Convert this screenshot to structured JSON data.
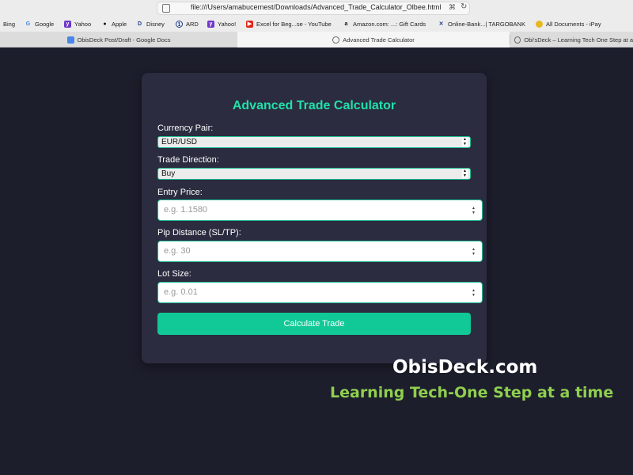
{
  "browser": {
    "url": "file:///Users/amabucernest/Downloads/Advanced_Trade_Calculator_Olbee.html",
    "bookmarks": [
      {
        "label": "Bing",
        "icon": "bing-icon"
      },
      {
        "label": "Google",
        "icon": "google-icon"
      },
      {
        "label": "Yahoo",
        "icon": "yahoo-icon"
      },
      {
        "label": "Apple",
        "icon": "apple-icon"
      },
      {
        "label": "Disney",
        "icon": "disney-icon"
      },
      {
        "label": "ARD",
        "icon": "ard-icon"
      },
      {
        "label": "Yahoo!",
        "icon": "yahoo-icon"
      },
      {
        "label": "Excel for Beg...se - YouTube",
        "icon": "youtube-icon"
      },
      {
        "label": "Amazon.com: ...: Gift Cards",
        "icon": "amazon-icon"
      },
      {
        "label": "Online-Bank...| TARGOBANK",
        "icon": "targobank-icon"
      },
      {
        "label": "All Documents - iPay",
        "icon": "ipay-icon"
      }
    ],
    "tabs": [
      {
        "label": "ObisDeck Post/Draft - Google Docs",
        "icon": "google-docs-icon"
      },
      {
        "label": "Advanced Trade Calculator",
        "icon": "page-icon"
      },
      {
        "label": "Obi'sDeck – Learning Tech One Step at a",
        "icon": "page-icon"
      }
    ]
  },
  "calculator": {
    "title": "Advanced Trade Calculator",
    "currency_pair": {
      "label": "Currency Pair:",
      "value": "EUR/USD"
    },
    "trade_direction": {
      "label": "Trade Direction:",
      "value": "Buy"
    },
    "entry_price": {
      "label": "Entry Price:",
      "placeholder": "e.g. 1.1580"
    },
    "pip_distance": {
      "label": "Pip Distance (SL/TP):",
      "placeholder": "e.g. 30"
    },
    "lot_size": {
      "label": "Lot Size:",
      "placeholder": "e.g. 0.01"
    },
    "button_label": "Calculate Trade"
  },
  "watermark": {
    "site": "ObisDeck.com",
    "tagline": "Learning Tech-One Step at a time"
  },
  "colors": {
    "background": "#1d1e2c",
    "card": "#2b2c40",
    "accent": "#21e0aa",
    "button": "#10c996",
    "tagline": "#8fcf4e"
  }
}
